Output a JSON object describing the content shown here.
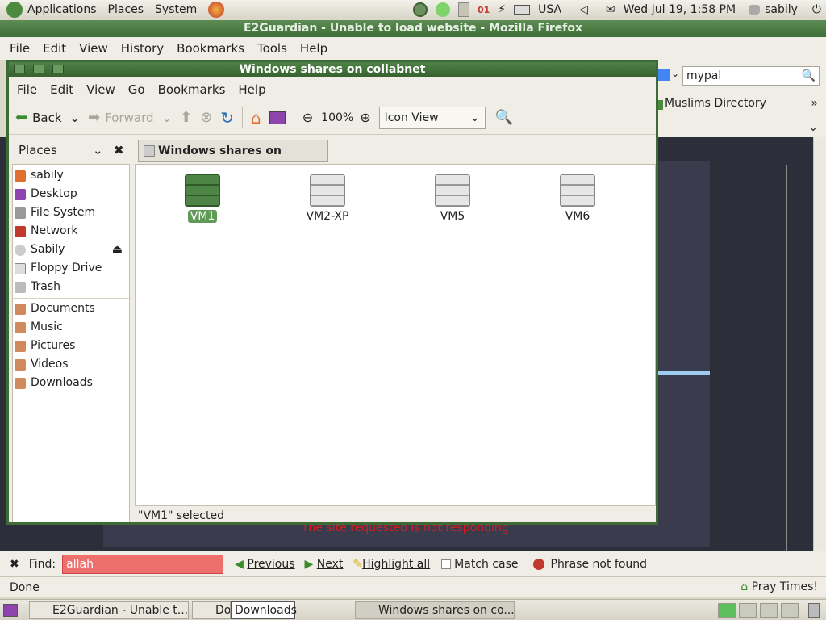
{
  "top_panel": {
    "menus": [
      "Applications",
      "Places",
      "System"
    ],
    "calendar_badge": "01",
    "keyboard_layout": "USA",
    "clock": "Wed Jul 19,  1:58 PM",
    "user": "sabily"
  },
  "firefox": {
    "title": "E2Guardian - Unable to load website - Mozilla Firefox",
    "menus": [
      "File",
      "Edit",
      "View",
      "History",
      "Bookmarks",
      "Tools",
      "Help"
    ],
    "search_value": "mypal",
    "bookmark_item": "Muslims Directory",
    "error_text": "The site requested is not responding",
    "find": {
      "label": "Find:",
      "value": "allah",
      "previous": "Previous",
      "next": "Next",
      "highlight": "Highlight all",
      "match_case": "Match case",
      "status": "Phrase not found"
    },
    "status_text": "Done",
    "pray_times": "Pray Times!"
  },
  "nautilus": {
    "title": "Windows shares on collabnet",
    "menus": [
      "File",
      "Edit",
      "View",
      "Go",
      "Bookmarks",
      "Help"
    ],
    "toolbar": {
      "back": "Back",
      "forward": "Forward",
      "zoom": "100%",
      "view_mode": "Icon View"
    },
    "places_header": "Places",
    "places": [
      "sabily",
      "Desktop",
      "File System",
      "Network",
      "Sabily",
      "Floppy Drive",
      "Trash"
    ],
    "bookmarks": [
      "Documents",
      "Music",
      "Pictures",
      "Videos",
      "Downloads"
    ],
    "location": "Windows shares on collabnet",
    "hosts": [
      "VM1",
      "VM2-XP",
      "VM5",
      "VM6"
    ],
    "selected_host": "VM1",
    "status": "\"VM1\" selected"
  },
  "bottom_panel": {
    "tasks": [
      "E2Guardian - Unable t...",
      "Do",
      "Downloads",
      "Windows shares on co..."
    ]
  },
  "colors": {
    "title_green": "#3e6e37",
    "selection_green": "#5f9a56",
    "find_error": "#ef6f6c",
    "error_text": "#d02020"
  }
}
